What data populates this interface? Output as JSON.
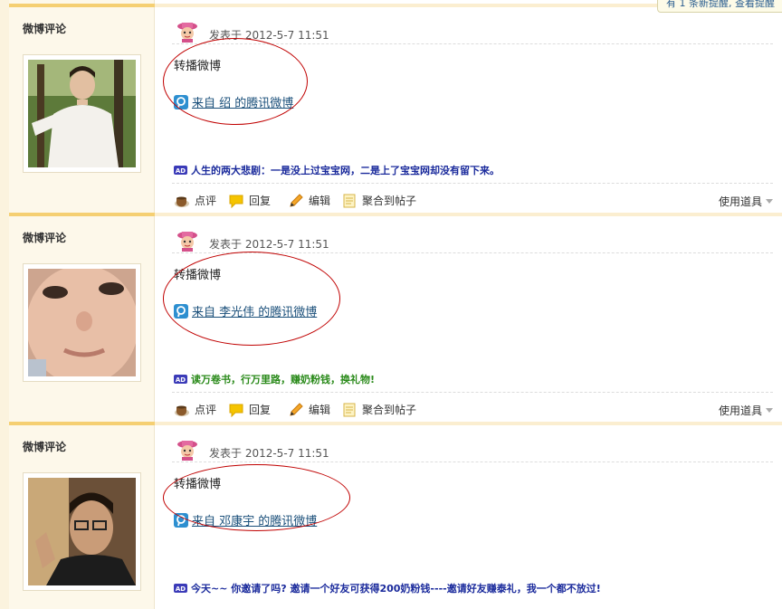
{
  "notice": {
    "text": "有 1 条新提醒, 查看提醒"
  },
  "common": {
    "actions": {
      "comment": "点评",
      "reply": "回复",
      "edit": "编辑",
      "aggregate": "聚合到帖子"
    },
    "tools_label": "使用道具",
    "ad_badge": "AD"
  },
  "posts": [
    {
      "author": "微博评论",
      "time": "发表于 2012-5-7 11:51",
      "text": "转播微博",
      "source": "来自 绍 的腾讯微博",
      "ad_text": "人生的两大悲剧：一是没上过宝宝网，二是上了宝宝网却没有留下来。",
      "ad_color": "#1a2a9c"
    },
    {
      "author": "微博评论",
      "time": "发表于 2012-5-7 11:51",
      "text": "转播微博",
      "source": "来自 李光伟 的腾讯微博",
      "ad_text": "读万卷书，行万里路，赚奶粉钱，换礼物!",
      "ad_color": "#2a8a1a"
    },
    {
      "author": "微博评论",
      "time": "发表于 2012-5-7 11:51",
      "text": "转播微博",
      "source": "来自 邓康宇 的腾讯微博",
      "ad_text": "今天~~ 你邀请了吗? 邀请一个好友可获得200奶粉钱----邀请好友赚泰礼，我一个都不放过!",
      "ad_color": "#1a2a9c"
    }
  ]
}
